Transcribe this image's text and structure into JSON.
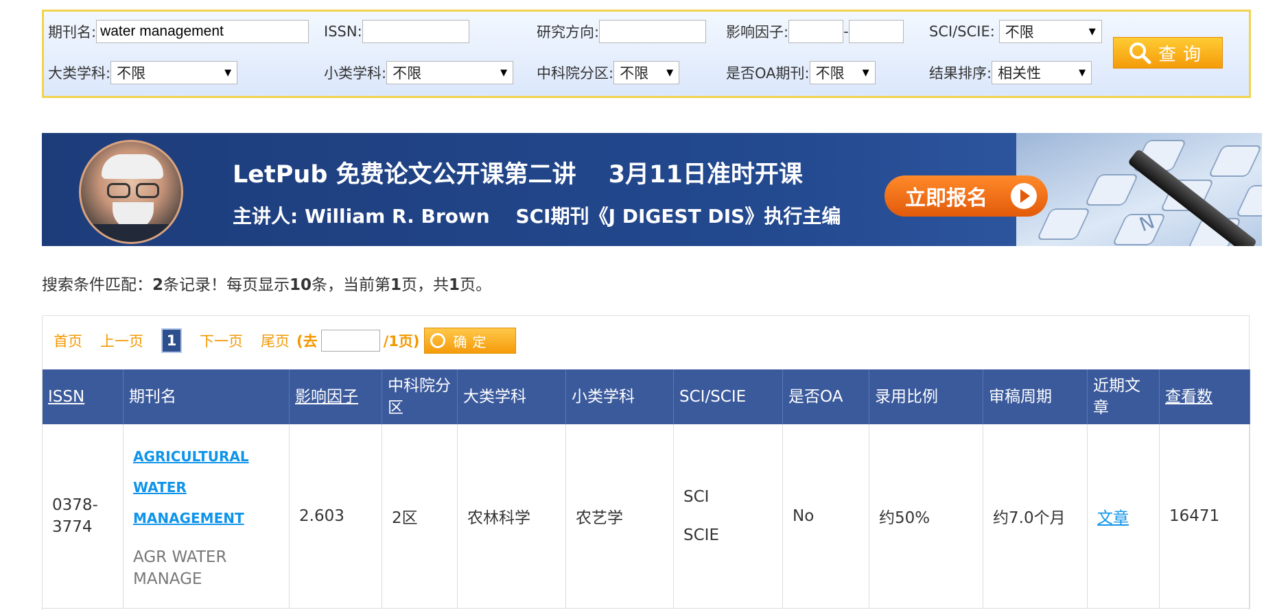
{
  "search": {
    "journal_name": {
      "label": "期刊名:",
      "value": "water management"
    },
    "issn": {
      "label": "ISSN:",
      "value": ""
    },
    "research_direction": {
      "label": "研究方向:",
      "value": ""
    },
    "impact_factor": {
      "label": "影响因子:",
      "min": "",
      "separator": "-",
      "max": ""
    },
    "sci_scie": {
      "label": "SCI/SCIE:",
      "selected": "不限"
    },
    "major_subject": {
      "label": "大类学科:",
      "selected": "不限"
    },
    "minor_subject": {
      "label": "小类学科:",
      "selected": "不限"
    },
    "cas_zone": {
      "label": "中科院分区:",
      "selected": "不限"
    },
    "oa": {
      "label": "是否OA期刊:",
      "selected": "不限"
    },
    "sort": {
      "label": "结果排序:",
      "selected": "相关性"
    },
    "search_button": "查询",
    "colors": {
      "panel_border": "#f2d34c",
      "button": "#f59b0a"
    }
  },
  "banner": {
    "line1": "LetPub 免费论文公开课第二讲　 3月11日准时开课",
    "line2": "主讲人: William R. Brown　 SCI期刊《J DIGEST DIS》执行主编",
    "cta": "立即报名",
    "key_letters": [
      "N"
    ]
  },
  "summary": {
    "prefix": "搜索条件匹配：",
    "count": "2",
    "part2": "条记录！每页显示",
    "per_page": "10",
    "part3": "条，当前第",
    "current": "1",
    "part4": "页，共",
    "total": "1",
    "part5": "页。"
  },
  "pager": {
    "first": "首页",
    "prev": "上一页",
    "current": "1",
    "next": "下一页",
    "last": "尾页",
    "goto_prefix": "(去",
    "goto_suffix": "/1页)",
    "ok_button": "确定"
  },
  "table": {
    "headers": {
      "issn": "ISSN",
      "name": "期刊名",
      "impact": "影响因子",
      "cas_zone": "中科院分区",
      "major": "大类学科",
      "minor": "小类学科",
      "sci": "SCI/SCIE",
      "oa": "是否OA",
      "accept": "录用比例",
      "review": "审稿周期",
      "recent": "近期文章",
      "views": "查看数"
    },
    "rows": [
      {
        "issn": "0378-3774",
        "name_lines": [
          "AGRICULTURAL",
          "WATER",
          "MANAGEMENT"
        ],
        "abbr": "AGR WATER MANAGE",
        "impact": "2.603",
        "cas_zone": "2区",
        "major": "农林科学",
        "minor": "农艺学",
        "sci": [
          "SCI",
          "SCIE"
        ],
        "oa": "No",
        "accept": "约50%",
        "review": "约7.0个月",
        "recent": "文章",
        "views": "16471"
      }
    ]
  }
}
